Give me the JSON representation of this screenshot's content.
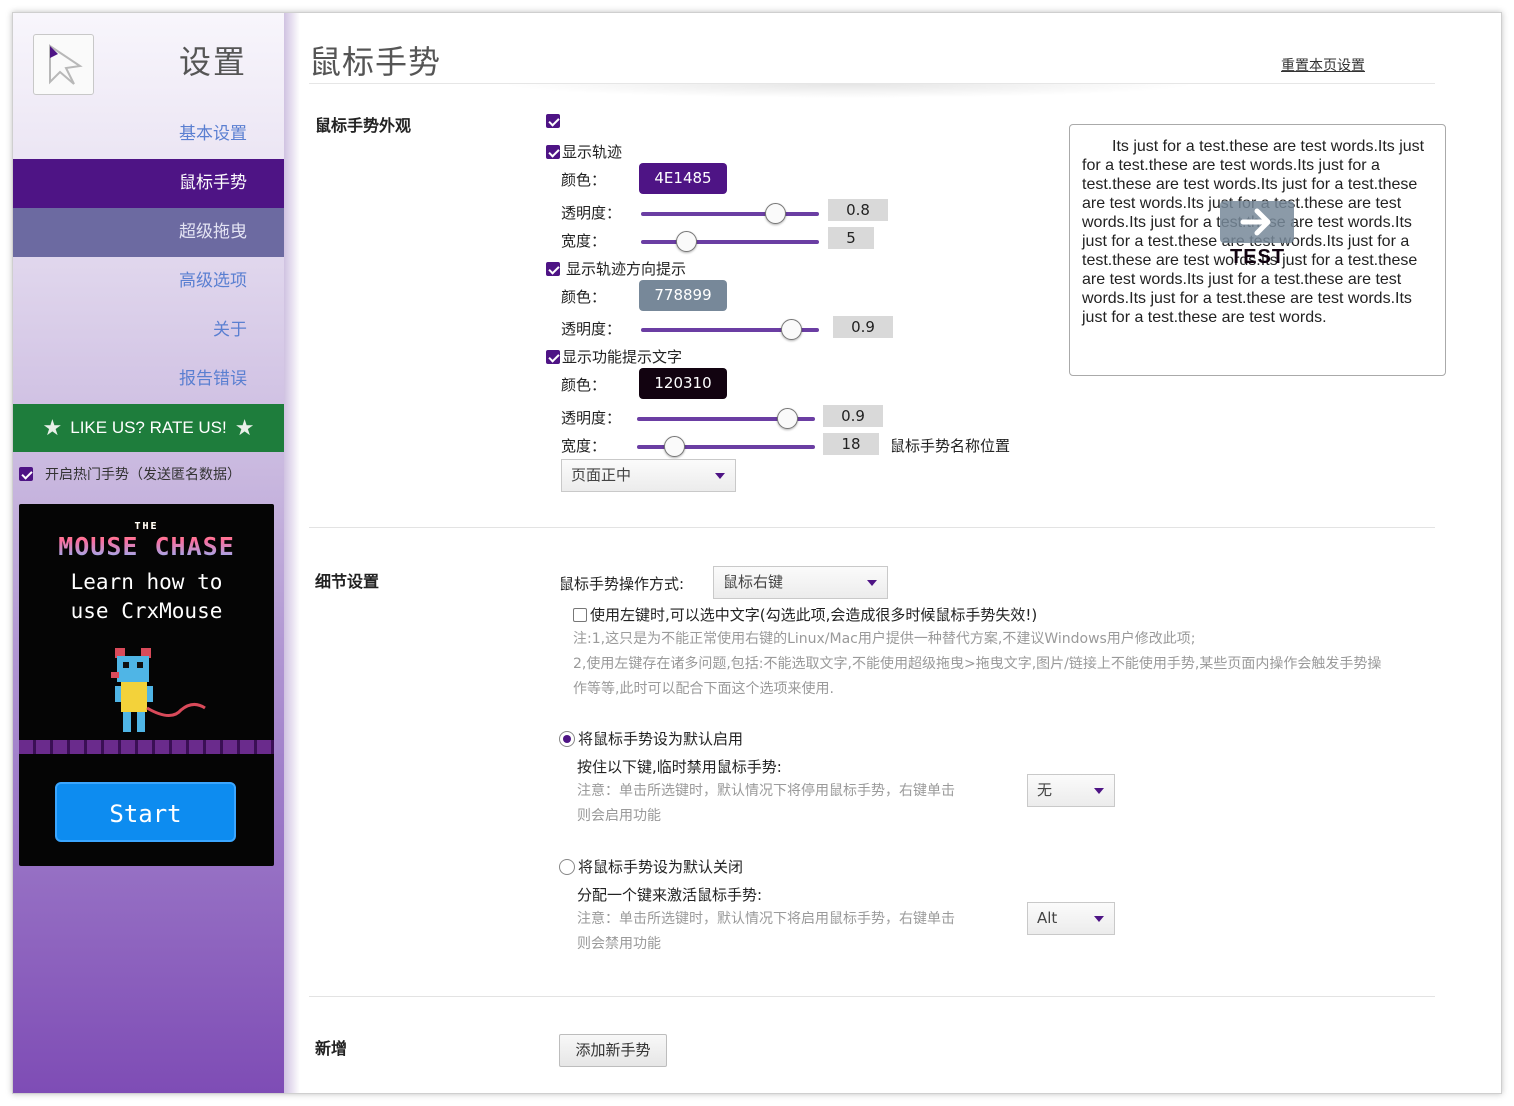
{
  "sidebar": {
    "title": "设置",
    "nav": [
      {
        "label": "基本设置"
      },
      {
        "label": "鼠标手势"
      },
      {
        "label": "超级拖曳"
      },
      {
        "label": "高级选项"
      },
      {
        "label": "关于"
      },
      {
        "label": "报告错误"
      }
    ],
    "rate_label": "LIKE US? RATE US!",
    "hot_gestures_label": "开启热门手势（发送匿名数据）",
    "ad": {
      "title_small": "THE",
      "title": "MOUSE CHASE",
      "line1": "Learn how to",
      "line2": "use CrxMouse",
      "button": "Start"
    }
  },
  "header": {
    "title": "鼠标手势",
    "reset_link": "重置本页设置"
  },
  "appearance": {
    "section_title": "鼠标手势外观",
    "show_trail_label": "显示轨迹",
    "trail": {
      "color_label": "颜色：",
      "color": "4E1485",
      "opacity_label": "透明度：",
      "opacity": "0.8",
      "width_label": "宽度：",
      "width": "5"
    },
    "show_direction_label": "显示轨迹方向提示",
    "direction": {
      "color_label": "颜色：",
      "color": "778899",
      "opacity_label": "透明度：",
      "opacity": "0.9"
    },
    "show_text_label": "显示功能提示文字",
    "text": {
      "color_label": "颜色：",
      "color": "120310",
      "opacity_label": "透明度：",
      "opacity": "0.9",
      "width_label": "宽度：",
      "width": "18",
      "position_label": "鼠标手势名称位置",
      "position_value": "页面正中"
    },
    "preview_text": "Its just for a test.these are test words.Its just for a test.these are test words.Its just for a test.these are test words.Its just for a test.these are test words.Its just for a test.these are test words.Its just for a test.these are test words.Its just for a test.these are test words.Its just for a test.these are test words.Its just for a test.these are test words.Its just for a test.these are test words.Its just for a test.these are test words.Its just for a test.these are test words.",
    "preview_label": "TEST"
  },
  "details": {
    "section_title": "细节设置",
    "mode_label": "鼠标手势操作方式:",
    "mode_value": "鼠标右键",
    "left_key_label": "使用左键时,可以选中文字(勾选此项,会造成很多时候鼠标手势失效!)",
    "note1": "注:1,这只是为不能正常使用右键的Linux/Mac用户提供一种替代方案,不建议Windows用户修改此项;",
    "note2": "2,使用左键存在诸多问题,包括:不能选取文字,不能使用超级拖曳>拖曳文字,图片/链接上不能使用手势,某些页面内操作会触发手势操",
    "note3": "作等等,此时可以配合下面这个选项来使用.",
    "default_on_label": "将鼠标手势设为默认启用",
    "default_on_sub": "按住以下键,临时禁用鼠标手势:",
    "default_on_note1": "注意：单击所选键时，默认情况下将停用鼠标手势，右键单击",
    "default_on_note2": "则会启用功能",
    "default_on_key": "无",
    "default_off_label": "将鼠标手势设为默认关闭",
    "default_off_sub": "分配一个键来激活鼠标手势:",
    "default_off_note1": "注意：单击所选键时，默认情况下将启用鼠标手势，右键单击",
    "default_off_note2": "则会禁用功能",
    "default_off_key": "Alt"
  },
  "add": {
    "section_title": "新增",
    "button": "添加新手势"
  },
  "colors": {
    "accent": "#4e1485",
    "trail": "#4E1485",
    "direction": "#778899",
    "text": "#120310",
    "rate": "#1e7d3c"
  }
}
